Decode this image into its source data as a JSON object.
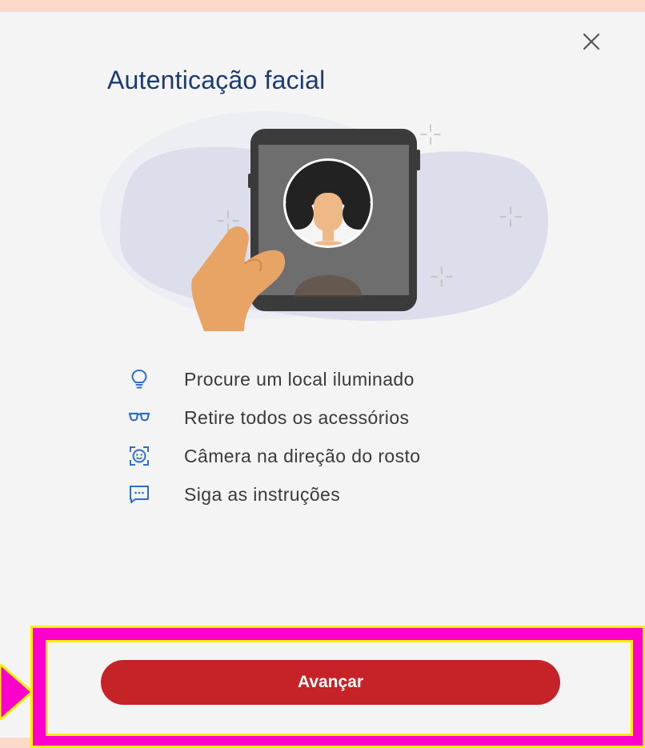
{
  "modal": {
    "title": "Autenticação facial",
    "close_icon": "close-icon"
  },
  "tips": [
    {
      "icon": "lightbulb-icon",
      "text": "Procure um local iluminado"
    },
    {
      "icon": "glasses-icon",
      "text": "Retire todos os acessórios"
    },
    {
      "icon": "face-scan-icon",
      "text": "Câmera na direção do rosto"
    },
    {
      "icon": "chat-message-icon",
      "text": "Siga as instruções"
    }
  ],
  "footer": {
    "primary_button_label": "Avançar"
  },
  "colors": {
    "title": "#1c3b73",
    "icon_blue": "#2d6fd1",
    "primary_button": "#c62328",
    "highlight_magenta": "#ff00cc",
    "highlight_yellow": "#f6f000",
    "page_background": "#fcd9c8"
  }
}
